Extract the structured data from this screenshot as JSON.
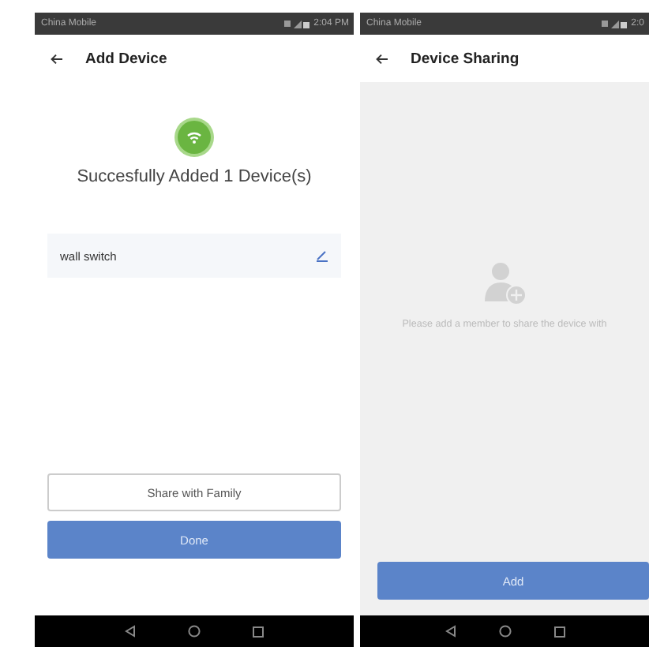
{
  "screens": [
    {
      "kind": "add_device",
      "status_bar": {
        "carrier": "China Mobile",
        "time": "2:04 PM"
      },
      "title": "Add Device",
      "message": "Succesfully Added 1 Device(s)",
      "devices": [
        {
          "name": "wall switch"
        }
      ],
      "buttons": [
        {
          "label": "Share with Family",
          "primary": false
        },
        {
          "label": "Done",
          "primary": true
        }
      ]
    },
    {
      "kind": "device_sharing",
      "status_bar": {
        "carrier": "China Mobile",
        "time": "2:0"
      },
      "title": "Device Sharing",
      "message": "Please add a member to share the device with",
      "buttons": [
        {
          "label": "Add",
          "primary": true
        }
      ]
    }
  ]
}
